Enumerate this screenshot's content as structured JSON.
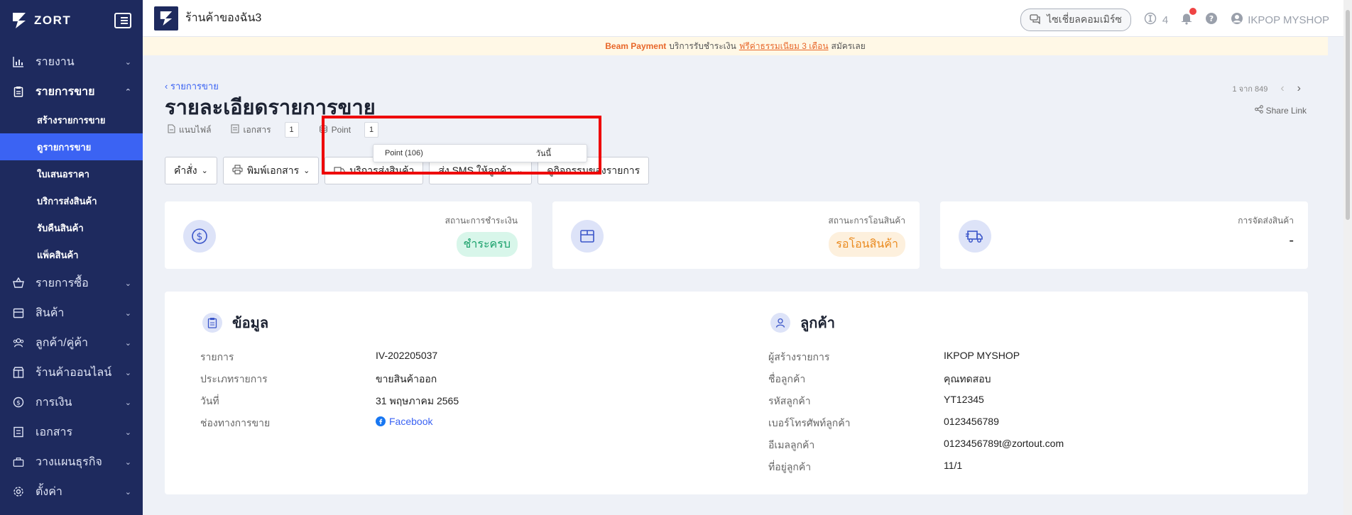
{
  "sidebar": {
    "brand": "ZORT",
    "items": [
      {
        "label": "รายงาน",
        "icon": "bar-chart-icon"
      },
      {
        "label": "รายการขาย",
        "icon": "clipboard-icon",
        "open": true,
        "sub": [
          "สร้างรายการขาย",
          "ดูรายการขาย",
          "ใบเสนอราคา",
          "บริการส่งสินค้า",
          "รับคืนสินค้า",
          "แพ็คสินค้า"
        ],
        "active_sub": 1
      },
      {
        "label": "รายการซื้อ",
        "icon": "basket-icon"
      },
      {
        "label": "สินค้า",
        "icon": "box-icon"
      },
      {
        "label": "ลูกค้า/คู่ค้า",
        "icon": "users-icon"
      },
      {
        "label": "ร้านค้าออนไลน์",
        "icon": "store-icon"
      },
      {
        "label": "การเงิน",
        "icon": "coin-icon"
      },
      {
        "label": "เอกสาร",
        "icon": "document-icon"
      },
      {
        "label": "วางแผนธุรกิจ",
        "icon": "briefcase-icon"
      },
      {
        "label": "ตั้งค่า",
        "icon": "gear-icon"
      }
    ]
  },
  "topbar": {
    "shop_name": "ร้านค้าของฉัน3",
    "community": "ไซเชี่ยลคอมเมิร์ซ",
    "info_count": "4",
    "user": "IKPOP MYSHOP"
  },
  "banner": {
    "brand": "Beam Payment",
    "text": "บริการรับชำระเงิน",
    "promo": "ฟรีค่าธรรมเนียม 3 เดือน",
    "cta": "สมัครเลย"
  },
  "header": {
    "breadcrumb": "รายการขาย",
    "title": "รายละเอียดรายการขาย",
    "pager": "1 จาก 849",
    "share": "Share Link"
  },
  "tabs": {
    "file": "แนบไฟล์",
    "docs": "เอกสาร",
    "docs_count": "1",
    "point": "Point",
    "point_count": "1"
  },
  "dropdown": {
    "item": "Point (106)",
    "date": "วันนี้"
  },
  "actions": {
    "command": "คำสั่ง",
    "print": "พิมพ์เอกสาร",
    "shipping": "บริการส่งสินค้า",
    "sms": "ส่ง SMS ให้ลูกค้า",
    "activity": "ดูกิจกรรมของรายการ"
  },
  "status": {
    "payment_label": "สถานะการชำระเงิน",
    "payment_value": "ชำระครบ",
    "transfer_label": "สถานะการโอนสินค้า",
    "transfer_value": "รอโอนสินค้า",
    "delivery_label": "การจัดส่งสินค้า",
    "delivery_value": "-"
  },
  "info": {
    "title": "ข้อมูล",
    "rows": [
      {
        "k": "รายการ",
        "v": "IV-202205037"
      },
      {
        "k": "ประเภทรายการ",
        "v": "ขายสินค้าออก"
      },
      {
        "k": "วันที่",
        "v": "31 พฤษภาคม 2565"
      },
      {
        "k": "ช่องทางการขาย",
        "v": "Facebook"
      }
    ]
  },
  "customer": {
    "title": "ลูกค้า",
    "rows": [
      {
        "k": "ผู้สร้างรายการ",
        "v": "IKPOP MYSHOP"
      },
      {
        "k": "ชื่อลูกค้า",
        "v": "คุณทดสอบ"
      },
      {
        "k": "รหัสลูกค้า",
        "v": "YT12345"
      },
      {
        "k": "เบอร์โทรศัพท์ลูกค้า",
        "v": "0123456789"
      },
      {
        "k": "อีเมลลูกค้า",
        "v": "0123456789t@zortout.com"
      },
      {
        "k": "ที่อยู่ลูกค้า",
        "v": "11/1"
      }
    ]
  }
}
